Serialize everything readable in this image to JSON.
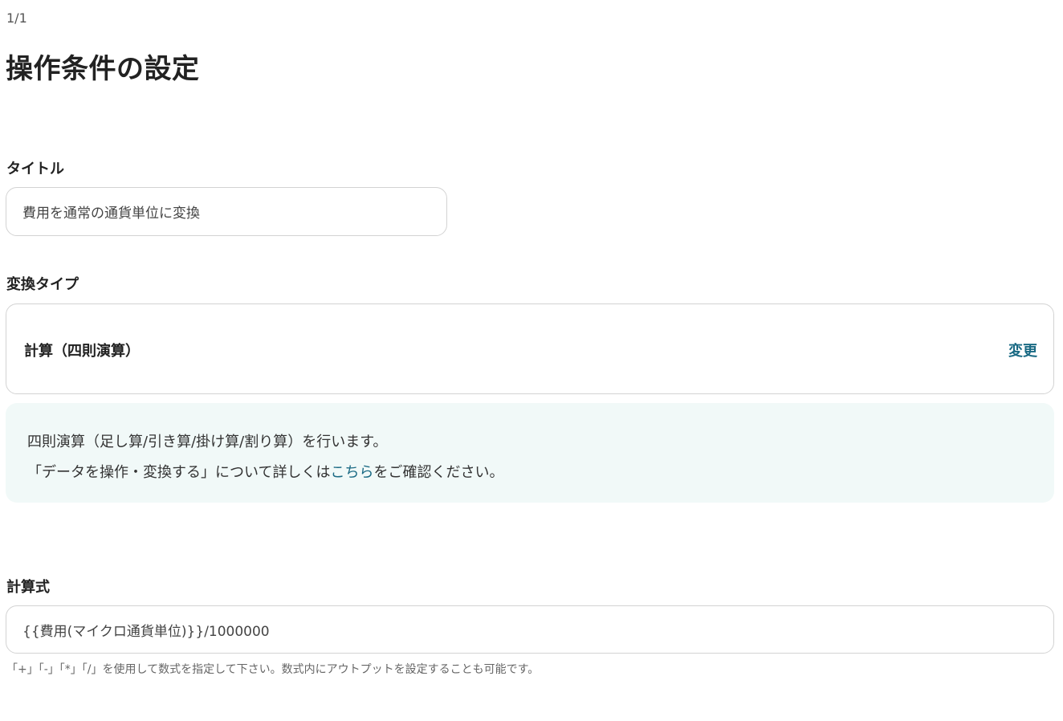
{
  "header": {
    "step_counter": "1/1",
    "page_title": "操作条件の設定"
  },
  "title_field": {
    "label": "タイトル",
    "value": "費用を通常の通貨単位に変換"
  },
  "conversion_type": {
    "label": "変換タイプ",
    "selected": "計算（四則演算）",
    "change_label": "変更"
  },
  "info": {
    "line1": "四則演算（足し算/引き算/掛け算/割り算）を行います。",
    "line2_before": "「データを操作・変換する」について詳しくは",
    "line2_link": "こちら",
    "line2_after": "をご確認ください。"
  },
  "formula_field": {
    "label": "計算式",
    "value": "{{費用(マイクロ通貨単位)}}/1000000",
    "help": "「+」「-」「*」「/」を使用して数式を指定して下さい。数式内にアウトプットを設定することも可能です。"
  },
  "colors": {
    "accent": "#1a6a84",
    "info_bg": "#f1f9f8",
    "border": "#d3d3d3"
  }
}
